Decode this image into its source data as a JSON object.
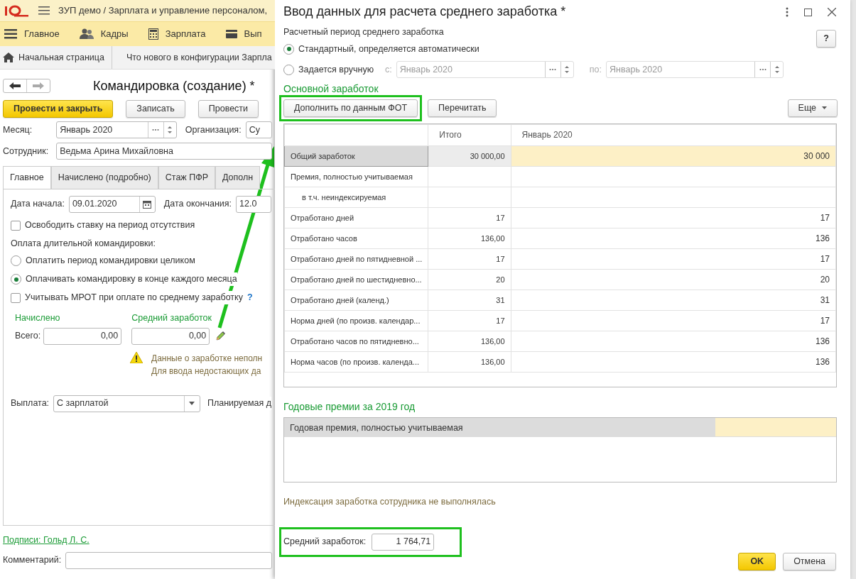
{
  "app": {
    "title": "ЗУП демо / Зарплата и управление персоналом,",
    "sections": [
      {
        "label": "Главное"
      },
      {
        "label": "Кадры"
      },
      {
        "label": "Зарплата"
      },
      {
        "label": "Вып"
      }
    ],
    "open_tabs": [
      {
        "label": "Начальная страница",
        "kind": "home"
      },
      {
        "label": "Что нового в конфигурации Зарпла",
        "kind": "page"
      }
    ]
  },
  "document": {
    "title": "Командировка (создание) *",
    "commands": [
      {
        "label": "Провести и закрыть",
        "default": true
      },
      {
        "label": "Записать",
        "default": false
      },
      {
        "label": "Провести",
        "default": false
      }
    ],
    "month_label": "Месяц:",
    "month": "Январь 2020",
    "org_label": "Организация:",
    "org": "Су",
    "employee_label": "Сотрудник:",
    "employee": "Ведьма Арина Михайловна",
    "tabs": [
      {
        "label": "Главное",
        "selected": true
      },
      {
        "label": "Начислено (подробно)",
        "selected": false
      },
      {
        "label": "Стаж ПФР",
        "selected": false
      },
      {
        "label": "Дополн",
        "selected": false
      }
    ],
    "start_label": "Дата начала:",
    "start": "09.01.2020",
    "end_label": "Дата окончания:",
    "end": "12.0",
    "release_rate": {
      "label": "Освободить ставку на период отсутствия",
      "checked": false
    },
    "long_trip_label": "Оплата длительной командировки:",
    "long_trip_options": [
      {
        "label": "Оплатить период командировки целиком",
        "selected": false
      },
      {
        "label": "Оплачивать командировку в конце каждого месяца",
        "selected": true
      }
    ],
    "mrot": {
      "label": "Учитывать МРОТ при оплате по среднему заработку",
      "checked": false,
      "help": "?"
    },
    "accrued_header": "Начислено",
    "total_label": "Всего:",
    "total": "0,00",
    "avg_header": "Средний заработок",
    "avg": "0,00",
    "warning": [
      "Данные о заработке неполн",
      "Для ввода недостающих да"
    ],
    "payout_label": "Выплата:",
    "payout": "С зарплатой",
    "planned_label": "Планируемая д",
    "signatures": "Подписи: Гольд Л. С.",
    "comment_label": "Комментарий:"
  },
  "dialog": {
    "title": "Ввод данных для расчета среднего заработка *",
    "help": "?",
    "period_label": "Расчетный период среднего заработка",
    "period_options": [
      {
        "label": "Стандартный, определяется автоматически",
        "selected": true
      },
      {
        "label": "Задается вручную",
        "selected": false
      }
    ],
    "from_label": "с:",
    "from": "Январь 2020",
    "to_label": "по:",
    "to": "Январь 2020",
    "period_fields_disabled": true,
    "main_header": "Основной заработок",
    "buttons": [
      {
        "label": "Дополнить по данным ФОТ",
        "highlighted": true
      },
      {
        "label": "Перечитать",
        "highlighted": false
      }
    ],
    "more": "Еще",
    "table": {
      "columns": [
        "Итого",
        "Январь 2020"
      ],
      "rows": [
        {
          "label": "Общий заработок",
          "total": "30 000,00",
          "month": "30 000",
          "selected": true
        },
        {
          "label": "Премия, полностью учитываемая",
          "selected": false,
          "children": [
            {
              "label": "в т.ч. неиндексируемая",
              "selected": false
            }
          ]
        },
        {
          "label": "Отработано дней",
          "total": "17",
          "month": "17",
          "selected": false
        },
        {
          "label": "Отработано часов",
          "total": "136,00",
          "month": "136",
          "selected": false
        },
        {
          "label": "Отработано дней по пятидневной ...",
          "total": "17",
          "month": "17",
          "selected": false
        },
        {
          "label": "Отработано дней по шестидневно...",
          "total": "20",
          "month": "20",
          "selected": false
        },
        {
          "label": "Отработано дней (календ.)",
          "total": "31",
          "month": "31",
          "selected": false
        },
        {
          "label": "Норма дней (по произв. календар...",
          "total": "17",
          "month": "17",
          "selected": false
        },
        {
          "label": "Отработано часов по пятидневно...",
          "total": "136,00",
          "month": "136",
          "selected": false
        },
        {
          "label": "Норма часов (по произв. календа...",
          "total": "136,00",
          "month": "136",
          "selected": false
        }
      ]
    },
    "bonus_header": "Годовые премии за 2019 год",
    "bonus_rows": [
      {
        "label": "Годовая премия, полностью учитываемая",
        "selected": true
      }
    ],
    "indexation": "Индексация заработка сотрудника не выполнялась",
    "avg_label": "Средний заработок:",
    "avg": "1 764,71",
    "avg_highlighted": true,
    "ok": "OK",
    "cancel": "Отмена"
  }
}
